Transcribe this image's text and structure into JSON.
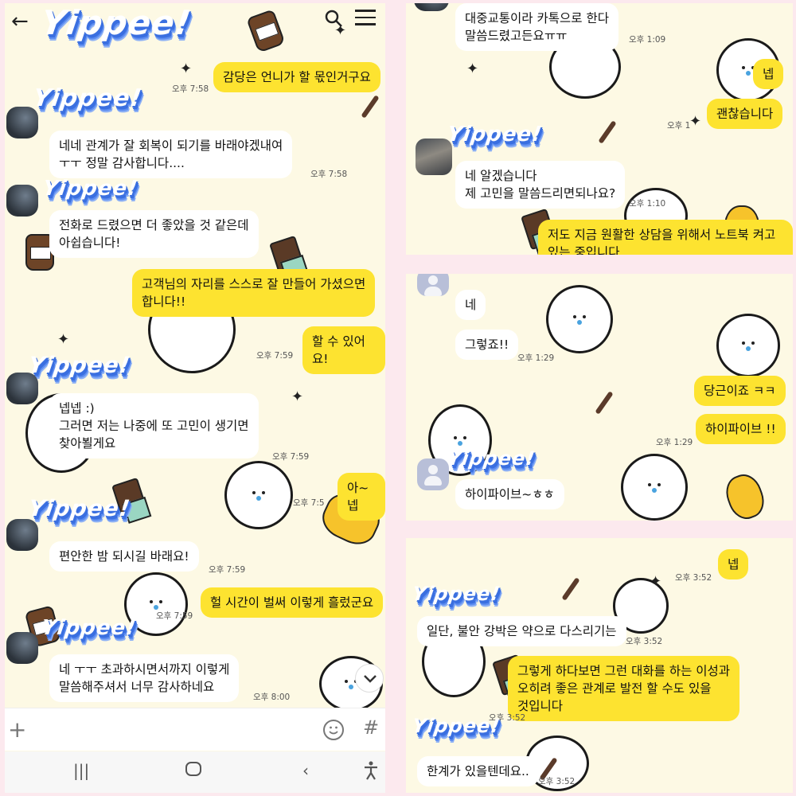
{
  "left": {
    "brand": "Yippee!",
    "messages": [
      {
        "text": "감당은 언니가 할 몫인거구요",
        "time": "오후 7:58"
      },
      {
        "text": "네네 관계가 잘 회복이 되기를 바래야겠내여\nㅜㅜ 정말 감사합니다....",
        "time": "오후 7:58"
      },
      {
        "text": "전화로 드렸으면 더 좋았을 것 같은데\n아쉽습니다!"
      },
      {
        "text": "고객님의 자리를 스스로 잘 만들어 가셨으면\n합니다!!"
      },
      {
        "text": "할 수 있어요!",
        "time": "오후 7:59"
      },
      {
        "text": "넵넵 :)\n그러면 저는 나중에 또 고민이 생기면\n찾아뵐게요",
        "time": "오후 7:59"
      },
      {
        "text": "아~ 넵",
        "time": "오후 7:5"
      },
      {
        "text": "편안한 밤 되시길 바래요!",
        "time": "오후 7:59"
      },
      {
        "text": "헐 시간이 벌써 이렇게 흘렀군요",
        "time": "오후 7:59"
      },
      {
        "text": "네 ㅜㅜ 초과하시면서까지 이렇게\n말씀해주셔서 너무 감사하네요",
        "time": "오후 8:00"
      }
    ]
  },
  "p1": {
    "messages": [
      {
        "text": "대중교통이라 카톡으로 한다\n말씀드렸고든요ㅠㅠ",
        "time": "오후 1:09"
      },
      {
        "text": "넵"
      },
      {
        "text": "괜찮습니다",
        "time": "오후 1"
      },
      {
        "text": "네 알겠습니다\n제 고민을 말씀드리면되나요?",
        "time": "오후 1:10"
      },
      {
        "text": "저도 지금 원활한 상담을 위해서 노트북 켜고\n있는 중입니다"
      }
    ]
  },
  "p2": {
    "messages": [
      {
        "text": "네"
      },
      {
        "text": "그렇죠!!",
        "time": "오후 1:29"
      },
      {
        "text": "당근이죠 ㅋㅋ"
      },
      {
        "text": "하이파이브 !!",
        "time": "오후 1:29"
      },
      {
        "text": "하이파이브~ㅎㅎ"
      }
    ]
  },
  "p3": {
    "messages": [
      {
        "text": "넵",
        "time": "오후 3:52"
      },
      {
        "text": "일단, 불안 강박은 약으로 다스리기는",
        "time": "오후 3:52"
      },
      {
        "text": "그렇게 하다보면 그런 대화를 하는 이성과\n오히려 좋은 관계로 발전 할 수도 있을\n것입니다",
        "time": "오후 3:52"
      },
      {
        "text": "한계가 있을텐데요..",
        "time": "오후 3:52"
      }
    ]
  },
  "icons": [
    "back-arrow-icon",
    "search-icon",
    "menu-icon",
    "plus-icon",
    "emoji-icon",
    "hash-icon",
    "recent-apps-icon",
    "home-icon",
    "back-icon",
    "accessibility-icon",
    "chevron-down-icon"
  ],
  "colors": {
    "bg": "#fdf9e4",
    "my_bubble": "#fde330",
    "their_bubble": "#ffffff",
    "frame": "#fce9ee",
    "yippee_shadow": "#3a6fe0"
  }
}
